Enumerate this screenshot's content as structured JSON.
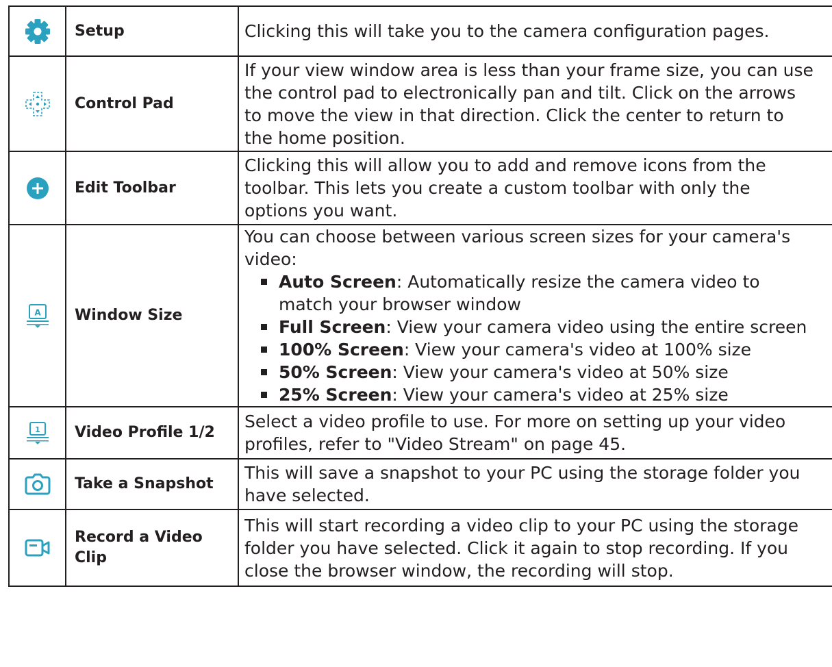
{
  "colors": {
    "icon_accent": "#2aa1bf",
    "text": "#231f20",
    "border": "#231f20"
  },
  "rows": [
    {
      "icon": "gear-icon",
      "name": "Setup",
      "desc": [
        "Clicking this will take you to the camera configuration pages."
      ]
    },
    {
      "icon": "control-pad-icon",
      "name": "Control Pad",
      "desc": [
        "If your view window area is less than your frame size, you can use",
        "the control pad to electronically pan and tilt. Click on the arrows",
        "to move the view in that direction. Click the center to return to",
        "the home position."
      ]
    },
    {
      "icon": "plus-circle-icon",
      "name": "Edit Toolbar",
      "desc": [
        "Clicking this will allow you to add and remove icons from the",
        "toolbar. This lets you create a custom toolbar with only the",
        "options you want."
      ]
    },
    {
      "icon": "window-size-icon",
      "name": "Window Size",
      "desc": [
        "You can choose between various screen sizes for your camera's",
        "video:"
      ],
      "options": [
        {
          "term": "Auto Screen",
          "text": ": Automatically resize the camera video to",
          "cont": "match your browser window"
        },
        {
          "term": "Full Screen",
          "text": ": View your camera video using the entire screen"
        },
        {
          "term": "100% Screen",
          "text": ": View your camera's video at 100% size"
        },
        {
          "term": "50% Screen",
          "text": ": View your camera's video at 50% size"
        },
        {
          "term": "25% Screen",
          "text": ": View your camera's video at 25% size"
        }
      ]
    },
    {
      "icon": "video-profile-icon",
      "icon_label": "1",
      "name": "Video Profile 1/2",
      "desc": [
        "Select a video profile to use. For more on setting up your video",
        "profiles, refer to \"Video Stream\" on page 45."
      ]
    },
    {
      "icon": "camera-icon",
      "name": "Take a Snapshot",
      "desc": [
        "This will save a snapshot to your PC using the storage folder you",
        "have selected."
      ]
    },
    {
      "icon": "video-camera-icon",
      "name_lines": [
        "Record a Video",
        "Clip"
      ],
      "desc": [
        "This will start recording a video clip to your PC using the storage",
        "folder you have selected. Click it again to stop recording. If you",
        "close the browser window, the recording will stop."
      ]
    }
  ]
}
